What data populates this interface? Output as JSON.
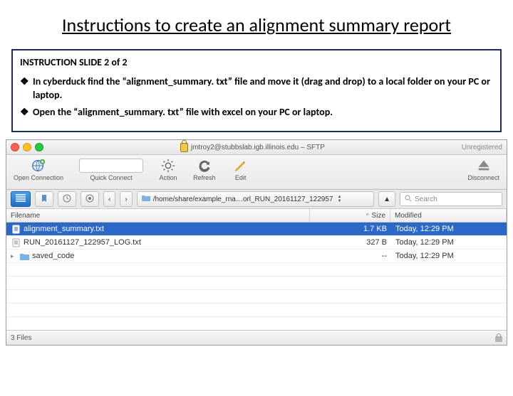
{
  "title_html": "Instructions to create an alignment summary report",
  "instruction_header": "INSTRUCTION SLIDE 2 of 2",
  "bullets": [
    "In cyberduck find the “alignment_summary. txt” file and move it (drag and drop) to a local folder on your PC or laptop.",
    "Open the “alignment_summary. txt” file  with excel on your PC or laptop."
  ],
  "window": {
    "connection": "jmtroy2@stubbslab.igb.illinois.edu – SFTP",
    "unregistered": "Unregistered"
  },
  "toolbar": {
    "open": "Open Connection",
    "quick": "Quick Connect",
    "action": "Action",
    "refresh": "Refresh",
    "edit": "Edit",
    "disconnect": "Disconnect"
  },
  "nav": {
    "back": "‹",
    "fwd": "›",
    "path": "/home/share/example_rna…orl_RUN_20161127_122957",
    "search_placeholder": "Search"
  },
  "columns": {
    "filename": "Filename",
    "size": "Size",
    "modified": "Modified"
  },
  "files": [
    {
      "name": "alignment_summary.txt",
      "size": "1.7 KB",
      "modified": "Today, 12:29 PM",
      "kind": "txt",
      "selected": true
    },
    {
      "name": "RUN_20161127_122957_LOG.txt",
      "size": "327 B",
      "modified": "Today, 12:29 PM",
      "kind": "txt",
      "selected": false
    },
    {
      "name": "saved_code",
      "size": "--",
      "modified": "Today, 12:29 PM",
      "kind": "folder",
      "selected": false
    }
  ],
  "status": "3 Files"
}
